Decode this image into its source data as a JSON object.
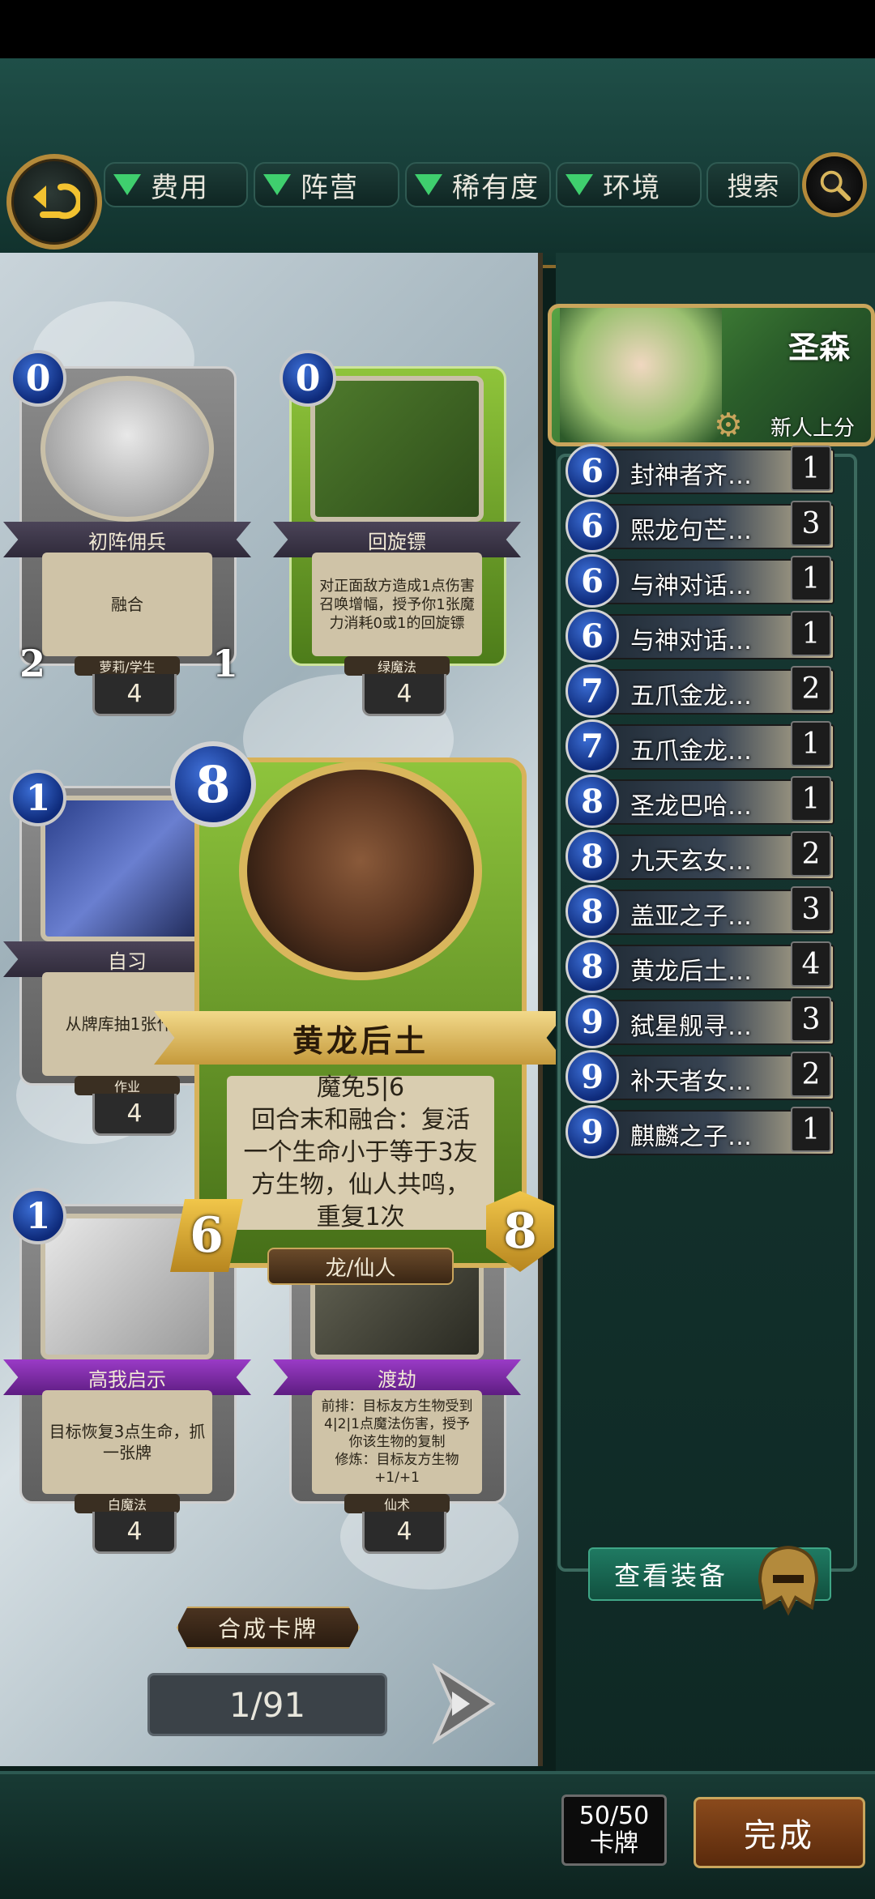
{
  "filters": {
    "cost": "费用",
    "faction": "阵营",
    "rarity": "稀有度",
    "environment": "环境",
    "search": "搜索"
  },
  "collection": {
    "cards": [
      {
        "cost": "0",
        "name": "初阵佣兵",
        "desc": "融合",
        "type": "萝莉/学生",
        "atk": "2",
        "hp": "1",
        "count": "4"
      },
      {
        "cost": "0",
        "name": "回旋镖",
        "desc": "对正面敌方造成1点伤害\n召唤增幅，授予你1张魔力消耗0或1的回旋镖",
        "type": "绿魔法",
        "count": "4"
      },
      {
        "cost": "1",
        "name": "自习",
        "desc": "从牌库抽1张作业",
        "type": "作业",
        "count": "4"
      },
      {
        "cost": "1",
        "name": "高我启示",
        "desc": "目标恢复3点生命，抓一张牌",
        "type": "白魔法",
        "count": "4"
      },
      {
        "name": "渡劫",
        "desc": "前排：目标友方生物受到4|2|1点魔法伤害，授予你该生物的复制\n修炼：目标友方生物+1/+1",
        "type": "仙术",
        "count": "4"
      }
    ],
    "featured": {
      "cost": "8",
      "name": "黄龙后土",
      "desc_lines": [
        "魔免5|6",
        "回合末和融合：复活",
        "一个生命小于等于3友",
        "方生物，仙人共鸣，",
        "重复1次"
      ],
      "type": "龙/仙人",
      "atk": "6",
      "hp": "8"
    },
    "craft_label": "合成卡牌",
    "page": "1/91"
  },
  "deck": {
    "name": "圣森",
    "mode": "新人上分",
    "entries": [
      {
        "cost": "6",
        "name": "封神者齐…",
        "qty": "1"
      },
      {
        "cost": "6",
        "name": "熙龙句芒…",
        "qty": "3"
      },
      {
        "cost": "6",
        "name": "与神对话…",
        "qty": "1"
      },
      {
        "cost": "6",
        "name": "与神对话…",
        "qty": "1"
      },
      {
        "cost": "7",
        "name": "五爪金龙…",
        "qty": "2"
      },
      {
        "cost": "7",
        "name": "五爪金龙…",
        "qty": "1"
      },
      {
        "cost": "8",
        "name": "圣龙巴哈…",
        "qty": "1"
      },
      {
        "cost": "8",
        "name": "九天玄女…",
        "qty": "2"
      },
      {
        "cost": "8",
        "name": "盖亚之子…",
        "qty": "3"
      },
      {
        "cost": "8",
        "name": "黄龙后土…",
        "qty": "4"
      },
      {
        "cost": "9",
        "name": "弑星舰寻…",
        "qty": "3"
      },
      {
        "cost": "9",
        "name": "补天者女…",
        "qty": "2"
      },
      {
        "cost": "9",
        "name": "麒麟之子…",
        "qty": "1"
      }
    ],
    "equip_label": "查看装备",
    "count_value": "50/50",
    "count_label": "卡牌",
    "done_label": "完成"
  },
  "colors": {
    "accent_gold": "#c9a55c",
    "filter_triangle": "#3fcf6e",
    "mana_blue": "#0e2a7a"
  }
}
